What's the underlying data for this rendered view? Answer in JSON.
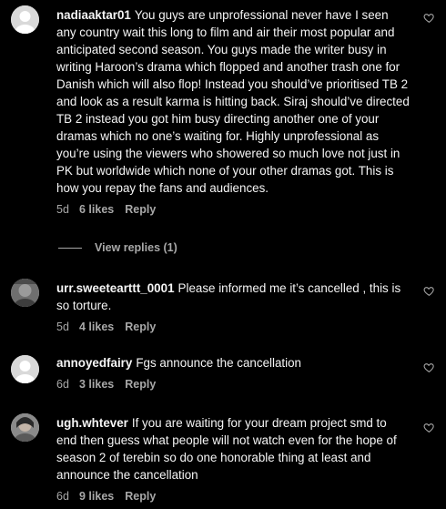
{
  "comments": [
    {
      "username": "nadiaaktar01",
      "text": "You guys are unprofessional never have I seen any country wait this long to film and air their most popular and anticipated second season. You guys made the writer busy in writing Haroon’s drama which flopped and another trash one for Danish which will also flop! Instead you should’ve prioritised TB 2 and look as a result karma is hitting back. Siraj should’ve directed TB 2 instead you got him busy directing another one of your dramas which no one’s waiting for. Highly unprofessional as you’re using the viewers who showered so much love not just in PK but worldwide which none of your other dramas got. This is how you repay the fans and audiences.",
      "age": "5d",
      "likes": "6 likes",
      "reply": "Reply",
      "view_replies": "View replies (1)"
    },
    {
      "username": "urr.sweetearttt_0001",
      "text": "Please informed me it’s cancelled , this is so torture.",
      "age": "5d",
      "likes": "4 likes",
      "reply": "Reply"
    },
    {
      "username": "annoyedfairy",
      "text": "Fgs announce the cancellation",
      "age": "6d",
      "likes": "3 likes",
      "reply": "Reply"
    },
    {
      "username": "ugh.whtever",
      "text": "If you are waiting for your dream project smd to end then guess what people will not watch even for the hope of season 2 of terebin so do one honorable thing at least and announce the cancellation",
      "age": "6d",
      "likes": "9 likes",
      "reply": "Reply"
    }
  ],
  "icons": {
    "like": "heart-outline-icon",
    "avatar": "default-avatar-icon"
  },
  "colors": {
    "background": "#000000",
    "text": "#f5f5f5",
    "secondary": "#a8a8a8"
  }
}
